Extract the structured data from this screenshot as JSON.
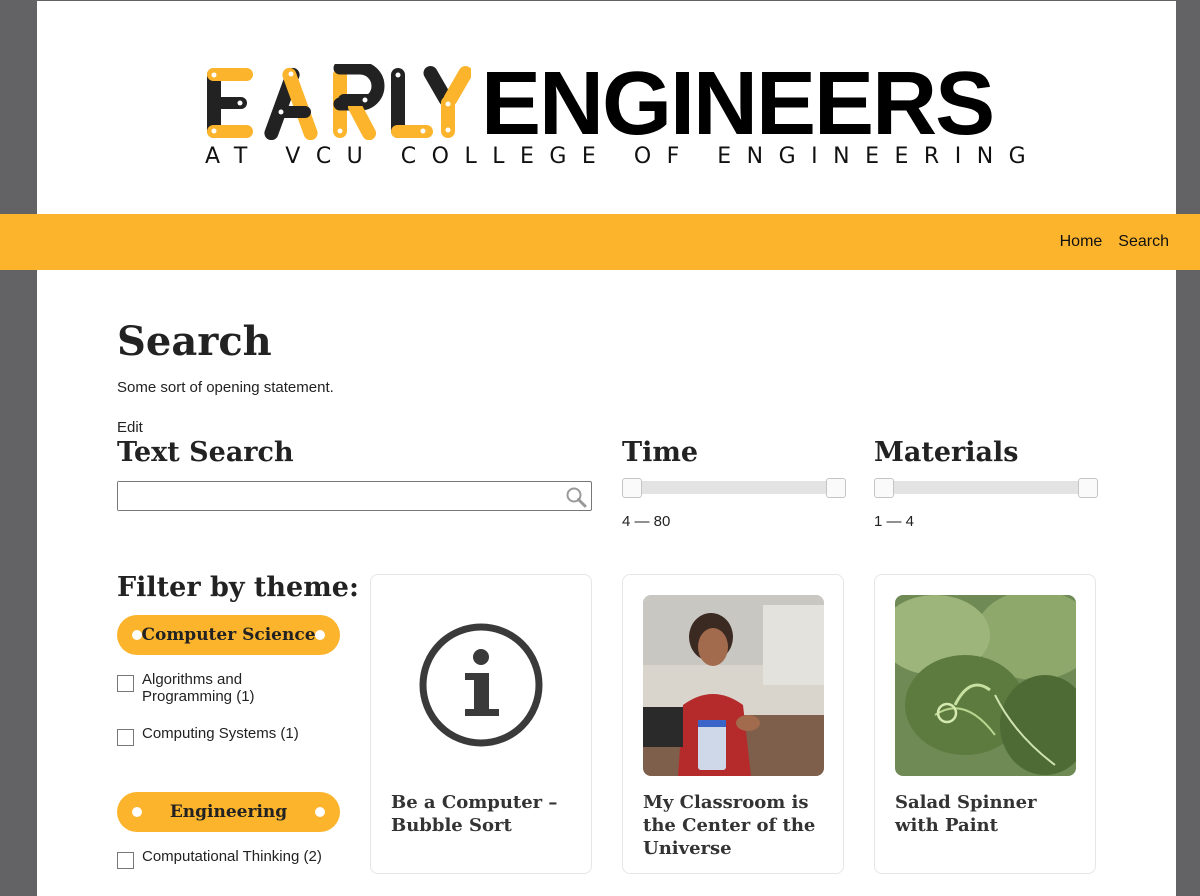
{
  "logo": {
    "word1_letters": [
      "E",
      "A",
      "R",
      "L",
      "Y"
    ],
    "word2": "ENGINEERS",
    "subtitle": "AT VCU COLLEGE OF ENGINEERING"
  },
  "nav": {
    "links": [
      {
        "label": "Home"
      },
      {
        "label": "Search"
      }
    ]
  },
  "page": {
    "title": "Search",
    "intro": "Some sort of opening statement.",
    "edit_label": "Edit"
  },
  "text_search": {
    "heading": "Text Search",
    "value": "",
    "placeholder": ""
  },
  "time": {
    "heading": "Time",
    "range_label": "4 — 80",
    "min": 4,
    "max": 80
  },
  "materials": {
    "heading": "Materials",
    "range_label": "1 — 4",
    "min": 1,
    "max": 4
  },
  "filters": {
    "heading": "Filter by theme:",
    "groups": [
      {
        "name": "Computer Science",
        "items": [
          {
            "label": "Algorithms and Programming (1)",
            "checked": false
          },
          {
            "label": "Computing Systems (1)",
            "checked": false
          }
        ]
      },
      {
        "name": "Engineering",
        "items": [
          {
            "label": "Computational Thinking (2)",
            "checked": false
          }
        ]
      }
    ]
  },
  "cards": [
    {
      "title": "Be a Computer – Bubble Sort",
      "image": "info-icon"
    },
    {
      "title": "My Classroom is the Center of the Universe",
      "image": "classroom-photo"
    },
    {
      "title": "Salad Spinner with Paint",
      "image": "plant-photo"
    }
  ],
  "colors": {
    "accent": "#fbb42c",
    "page_bg": "#636366",
    "text": "#222222"
  }
}
